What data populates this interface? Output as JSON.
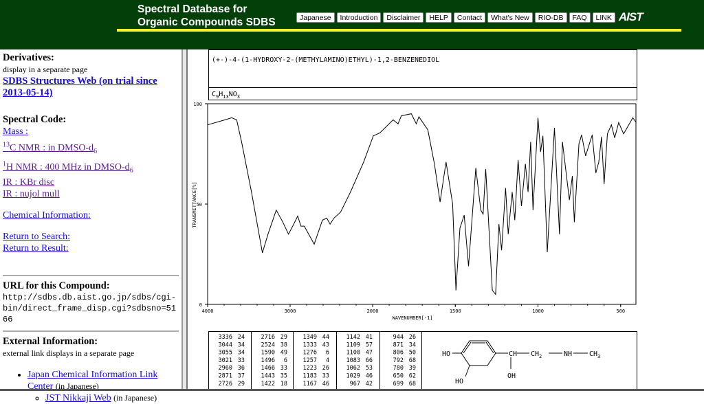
{
  "header": {
    "title_line1": "Spectral Database for",
    "title_line2": "Organic Compounds SDBS",
    "nav": [
      "Japanese",
      "Introduction",
      "Disclaimer",
      "HELP",
      "Contact",
      "What's New",
      "RIO-DB",
      "FAQ",
      "LINK"
    ],
    "logo": "AIST",
    "bg_color": "#033f08",
    "line_color": "#f4f22c"
  },
  "sidebar": {
    "derivatives_heading": "Derivatives:",
    "derivatives_note": "display in a separate page",
    "structures_link": "SDBS Structures Web (on trial since 2013-05-14)",
    "spectral_heading": "Spectral Code:",
    "codes": [
      {
        "pre": "",
        "label": "Mass :",
        "sub": ""
      },
      {
        "pre": "13",
        "label": "C NMR : in DMSO-d",
        "sub": "6"
      },
      {
        "pre": "1",
        "label": "H NMR : 400 MHz in DMSO-d",
        "sub": "6"
      },
      {
        "pre": "",
        "label": "IR : KBr disc",
        "sub": ""
      },
      {
        "pre": "",
        "label": "IR : nujol mull",
        "sub": ""
      }
    ],
    "chem_info": "Chemical Information:",
    "return_search": "Return to Search:",
    "return_result": "Return to Result:",
    "url_heading": "URL for this Compound:",
    "url": "http://sdbs.db.aist.go.jp/sdbs/cgi-bin/direct_frame_disp.cgi?sdbsno=5166",
    "ext_heading": "External Information:",
    "ext_note": "external link displays in a separate page",
    "jcl": "Japan Chemical Information Link Center",
    "jcl_note": "(in Japanese)",
    "jst": "JST Nikkaji Web",
    "jst_note": "(in Japanese)"
  },
  "compound": {
    "name": "(+-)-4-(1-HYDROXY-2-(METHYLAMINO)ETHYL)-1,2-BENZENEDIOL",
    "formula": "C9H13NO3"
  },
  "chart_data": {
    "type": "line",
    "xlabel": "WAVENUMBER[-1]",
    "ylabel": "TRANSMITTANCE[%]",
    "xlim": [
      4000,
      400
    ],
    "ylim": [
      0,
      100
    ],
    "xticks": [
      4000,
      3000,
      2000,
      1500,
      1000,
      500
    ],
    "yticks": [
      0,
      50,
      100
    ],
    "grid": false,
    "x": [
      4000,
      3788,
      3708,
      3648,
      3588,
      3468,
      3336,
      3268,
      3168,
      3088,
      3020,
      2968,
      2908,
      2868,
      2828,
      2708,
      2608,
      2556,
      2516,
      2468,
      2388,
      2268,
      2108,
      1996,
      1956,
      1876,
      1846,
      1826,
      1766,
      1736,
      1720,
      1666,
      1626,
      1592,
      1556,
      1516,
      1496,
      1472,
      1446,
      1420,
      1376,
      1346,
      1332,
      1316,
      1276,
      1256,
      1236,
      1220,
      1196,
      1180,
      1156,
      1140,
      1120,
      1100,
      1076,
      1060,
      1044,
      1030,
      1000,
      984,
      970,
      944,
      900,
      870,
      852,
      810,
      792,
      780,
      752,
      736,
      712,
      672,
      650,
      632,
      616,
      600,
      580,
      556,
      536,
      512,
      482,
      426,
      406
    ],
    "y": [
      89.5,
      92,
      93,
      92,
      81,
      56,
      25.7,
      35,
      47,
      41,
      35,
      39,
      44,
      39,
      39,
      30,
      42,
      43,
      40,
      43,
      46,
      56,
      71,
      84,
      85.5,
      92,
      90,
      94,
      95,
      90,
      93.5,
      87,
      70,
      51,
      71,
      50,
      7,
      38,
      44.5,
      19,
      68,
      47,
      45,
      67.5,
      7,
      5,
      40,
      27,
      58,
      35,
      56,
      42,
      72,
      49,
      70,
      56,
      81,
      47,
      93,
      76,
      84,
      26,
      88,
      35,
      81,
      52,
      64,
      41,
      80,
      84.5,
      74,
      84.5,
      65.5,
      71,
      83.5,
      60,
      85,
      89.5,
      83,
      90.6,
      85,
      93,
      90.6
    ]
  },
  "peaks": [
    [
      [
        "3336",
        "24"
      ],
      [
        "3044",
        "34"
      ],
      [
        "3055",
        "34"
      ],
      [
        "3021",
        "33"
      ],
      [
        "2960",
        "36"
      ],
      [
        "2871",
        "37"
      ],
      [
        "2726",
        "29"
      ]
    ],
    [
      [
        "2716",
        "29"
      ],
      [
        "2524",
        "38"
      ],
      [
        "1590",
        "49"
      ],
      [
        "1496",
        "6"
      ],
      [
        "1466",
        "33"
      ],
      [
        "1443",
        "35"
      ],
      [
        "1422",
        "18"
      ]
    ],
    [
      [
        "1349",
        "44"
      ],
      [
        "1333",
        "43"
      ],
      [
        "1276",
        "6"
      ],
      [
        "1257",
        "4"
      ],
      [
        "1223",
        "26"
      ],
      [
        "1183",
        "33"
      ],
      [
        "1167",
        "46"
      ]
    ],
    [
      [
        "1142",
        "41"
      ],
      [
        "1109",
        "57"
      ],
      [
        "1100",
        "47"
      ],
      [
        "1083",
        "66"
      ],
      [
        "1062",
        "53"
      ],
      [
        "1029",
        "46"
      ],
      [
        "967",
        "42"
      ]
    ],
    [
      [
        "944",
        "26"
      ],
      [
        "871",
        "34"
      ],
      [
        "806",
        "50"
      ],
      [
        "792",
        "68"
      ],
      [
        "780",
        "39"
      ],
      [
        "650",
        "62"
      ],
      [
        "699",
        "68"
      ]
    ]
  ],
  "structure": {
    "ho1": "HO",
    "ho2": "HO",
    "ch": "CH",
    "ch2": "CH",
    "ch2_sub": "2",
    "nh": "NH",
    "ch3": "CH",
    "ch3_sub": "3",
    "oh": "OH"
  }
}
